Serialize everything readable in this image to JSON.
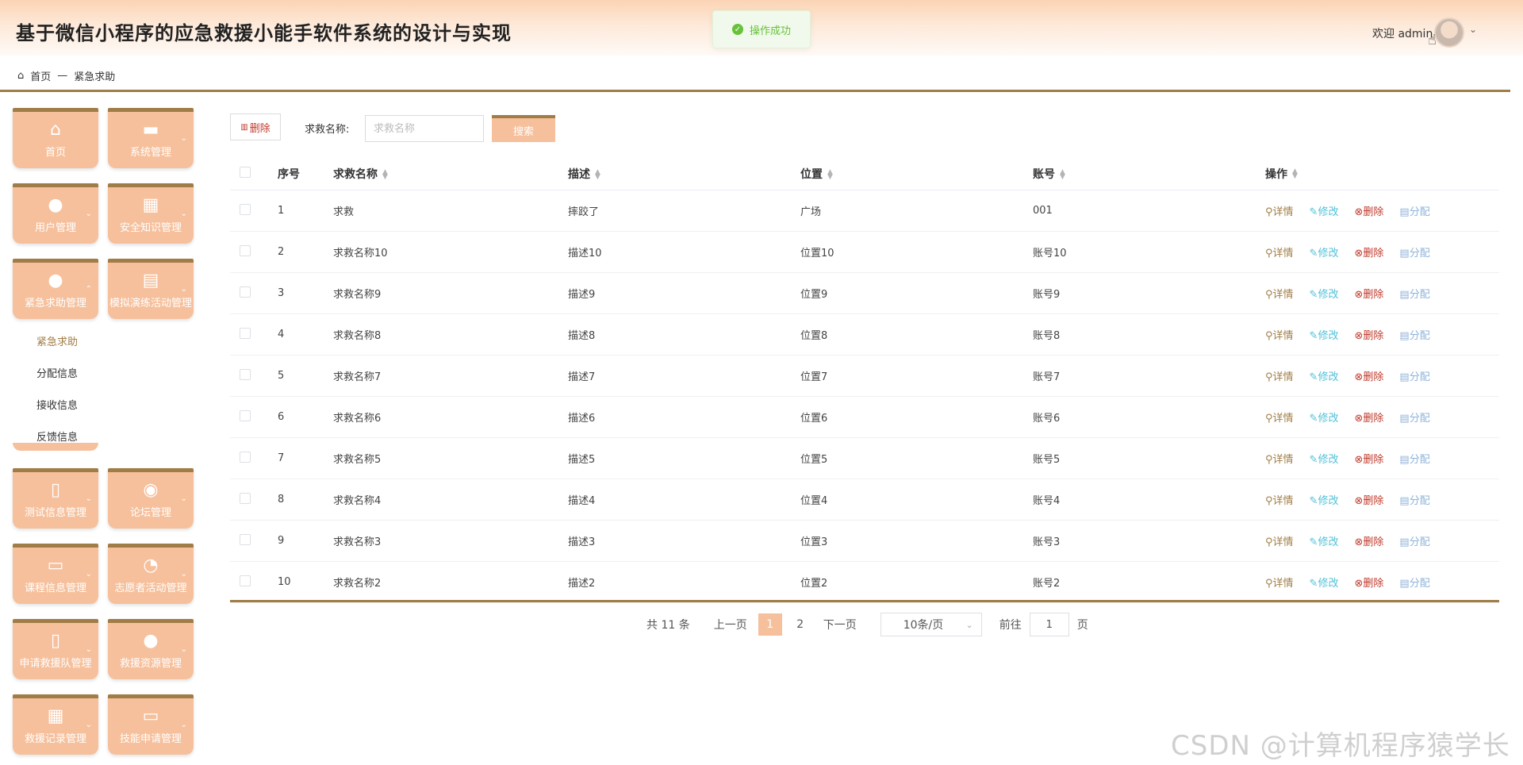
{
  "app": {
    "title": "基于微信小程序的应急救援小能手软件系统的设计与实现"
  },
  "toast": {
    "text": "操作成功"
  },
  "user": {
    "welcome": "欢迎 admin"
  },
  "breadcrumb": {
    "home": "首页",
    "separator": "—",
    "current": "紧急求助"
  },
  "sidebar": {
    "tiles": [
      {
        "label": "首页",
        "icon": "home-icon"
      },
      {
        "label": "系统管理",
        "icon": "window-icon"
      },
      {
        "label": "用户管理",
        "icon": "user-icon"
      },
      {
        "label": "安全知识管理",
        "icon": "grid-icon"
      },
      {
        "label": "紧急求助管理",
        "icon": "drop-icon"
      },
      {
        "label": "模拟演练活动管理",
        "icon": "shop-icon"
      },
      {
        "label": "测试信息管理",
        "icon": "doc-icon"
      },
      {
        "label": "论坛管理",
        "icon": "compass-icon"
      },
      {
        "label": "课程信息管理",
        "icon": "inbox-icon"
      },
      {
        "label": "志愿者活动管理",
        "icon": "pie-icon"
      },
      {
        "label": "申请救援队管理",
        "icon": "doc-icon"
      },
      {
        "label": "救援资源管理",
        "icon": "drop-icon"
      },
      {
        "label": "救援记录管理",
        "icon": "dashboard-icon"
      },
      {
        "label": "技能申请管理",
        "icon": "wallet-icon"
      }
    ],
    "submenu": [
      "紧急求助",
      "分配信息",
      "接收信息",
      "反馈信息"
    ]
  },
  "toolbar": {
    "delete_label": "删除",
    "search_label": "求救名称:",
    "search_placeholder": "求救名称",
    "search_button": "搜索"
  },
  "table": {
    "headers": {
      "index": "序号",
      "name": "求救名称",
      "desc": "描述",
      "position": "位置",
      "account": "账号",
      "ops": "操作"
    },
    "actions": {
      "detail": "详情",
      "edit": "修改",
      "delete": "删除",
      "assign": "分配"
    },
    "rows": [
      {
        "index": "1",
        "name": "求救",
        "desc": "摔跤了",
        "position": "广场",
        "account": "001"
      },
      {
        "index": "2",
        "name": "求救名称10",
        "desc": "描述10",
        "position": "位置10",
        "account": "账号10"
      },
      {
        "index": "3",
        "name": "求救名称9",
        "desc": "描述9",
        "position": "位置9",
        "account": "账号9"
      },
      {
        "index": "4",
        "name": "求救名称8",
        "desc": "描述8",
        "position": "位置8",
        "account": "账号8"
      },
      {
        "index": "5",
        "name": "求救名称7",
        "desc": "描述7",
        "position": "位置7",
        "account": "账号7"
      },
      {
        "index": "6",
        "name": "求救名称6",
        "desc": "描述6",
        "position": "位置6",
        "account": "账号6"
      },
      {
        "index": "7",
        "name": "求救名称5",
        "desc": "描述5",
        "position": "位置5",
        "account": "账号5"
      },
      {
        "index": "8",
        "name": "求救名称4",
        "desc": "描述4",
        "position": "位置4",
        "account": "账号4"
      },
      {
        "index": "9",
        "name": "求救名称3",
        "desc": "描述3",
        "position": "位置3",
        "account": "账号3"
      },
      {
        "index": "10",
        "name": "求救名称2",
        "desc": "描述2",
        "position": "位置2",
        "account": "账号2"
      }
    ]
  },
  "pagination": {
    "total": "共 11 条",
    "prev": "上一页",
    "pages": [
      "1",
      "2"
    ],
    "current": "1",
    "next": "下一页",
    "page_size": "10条/页",
    "goto_label": "前往",
    "goto_value": "1",
    "goto_suffix": "页"
  },
  "watermark": "CSDN @计算机程序猿学长",
  "colors": {
    "accent": "#a07d46",
    "tile": "#f6c09c",
    "header_gradient": "#fbd4b4",
    "success": "#67c23a"
  }
}
